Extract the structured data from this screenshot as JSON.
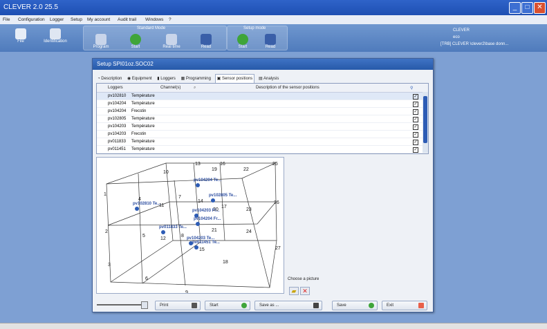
{
  "app": {
    "title": "CLEVER 2.0 25.5"
  },
  "menu": [
    "File",
    "Configuration",
    "Logger",
    "Setup",
    "My account",
    "Audit trail",
    "Windows",
    "?"
  ],
  "ribbon": {
    "buttons": [
      {
        "label": "File",
        "icon": "file-icon"
      },
      {
        "label": "Identification",
        "icon": "identification-icon"
      },
      {
        "label": "Program",
        "icon": "program-icon"
      },
      {
        "label": "Start",
        "icon": "start-icon"
      },
      {
        "label": "Real time",
        "icon": "realtime-icon"
      },
      {
        "label": "Read",
        "icon": "read-icon"
      },
      {
        "label": "Start",
        "icon": "setup-start-icon"
      },
      {
        "label": "Read",
        "icon": "setup-read-icon"
      }
    ],
    "group_standard": "Standard Mode",
    "group_setup": "Setup mode"
  },
  "user": {
    "line1": "CLEVER",
    "line2": "eco",
    "line3": "[TRB] CLEVER \\clever2\\base donn..."
  },
  "dialog": {
    "title": "Setup SPI01oz.SOC02",
    "tabs": [
      "Description",
      "Equipment",
      "Loggers",
      "Programming",
      "Sensor positions",
      "Analysis"
    ],
    "active_tab": 4,
    "table": {
      "headers": [
        "Loggers",
        "Channel(s)",
        "Description of the sensor positions"
      ],
      "rows": [
        {
          "logger": "pv102810",
          "channel": "Température",
          "checked": true
        },
        {
          "logger": "pv104204",
          "channel": "Température",
          "checked": true
        },
        {
          "logger": "pv104204",
          "channel": "Frecstin",
          "checked": true
        },
        {
          "logger": "pv102805",
          "channel": "Température",
          "checked": true
        },
        {
          "logger": "pv104203",
          "channel": "Température",
          "checked": true
        },
        {
          "logger": "pv104203",
          "channel": "Frecstin",
          "checked": true
        },
        {
          "logger": "pv011833",
          "channel": "Température",
          "checked": true
        },
        {
          "logger": "pv011451",
          "channel": "Température",
          "checked": true
        }
      ]
    },
    "viz": {
      "numbers": [
        "1",
        "2",
        "3",
        "4",
        "5",
        "6",
        "7",
        "8",
        "9",
        "10",
        "11",
        "12",
        "13",
        "14",
        "15",
        "16",
        "17",
        "18",
        "19",
        "20",
        "21",
        "22",
        "23",
        "24",
        "25",
        "26",
        "27"
      ],
      "sensor_labels": [
        "pv104204 Te...",
        "pv102810 Te...",
        "pv102805 Te...",
        "pv104203 Fr...",
        "pv104204 Fr...",
        "pv011833 Te...",
        "pv011451 Te...",
        "pv104203 Te..."
      ]
    },
    "choose_picture": "Choose a picture",
    "buttons": {
      "print": "Print",
      "start": "Start",
      "save_as": "Save as ...",
      "save": "Save",
      "exit": "Exit"
    }
  },
  "colors": {
    "accent": "#2d5cb5",
    "background": "#7ea0d3",
    "titlebar": "#1d4fb3"
  }
}
